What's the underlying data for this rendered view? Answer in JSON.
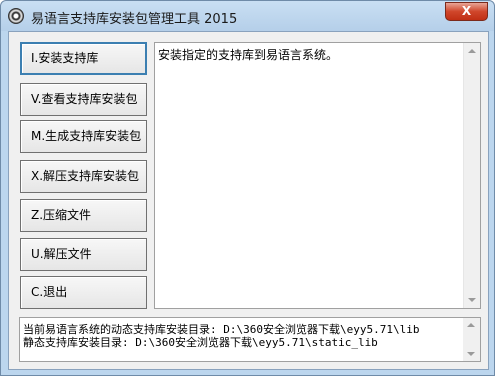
{
  "window": {
    "title": "易语言支持库安装包管理工具 2015",
    "close_label": "X"
  },
  "buttons": [
    {
      "label": "I.安装支持库"
    },
    {
      "label": "V.查看支持库安装包"
    },
    {
      "label": "M.生成支持库安装包"
    },
    {
      "label": "X.解压支持库安装包"
    },
    {
      "label": "Z.压缩文件"
    },
    {
      "label": "U.解压文件"
    },
    {
      "label": "C.退出"
    }
  ],
  "description": "安装指定的支持库到易语言系统。",
  "paths": {
    "dynamic": "当前易语言系统的动态支持库安装目录: D:\\360安全浏览器下载\\eyy5.71\\lib",
    "static": "静态支持库安装目录: D:\\360安全浏览器下载\\eyy5.71\\static_lib"
  }
}
